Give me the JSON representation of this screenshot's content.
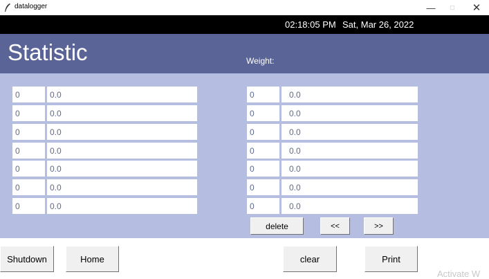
{
  "window": {
    "title": "datalogger",
    "icon": "feather-icon",
    "minimize_glyph": "—",
    "maximize_glyph": "□",
    "close_glyph": "✕"
  },
  "clock": {
    "time": "02:18:05 PM",
    "date": "Sat, Mar 26, 2022"
  },
  "header": {
    "title": "Statistic",
    "weight_label": "Weight:"
  },
  "left_rows": [
    {
      "index": "0",
      "value": "0.0"
    },
    {
      "index": "0",
      "value": "0.0"
    },
    {
      "index": "0",
      "value": "0.0"
    },
    {
      "index": "0",
      "value": "0.0"
    },
    {
      "index": "0",
      "value": "0.0"
    },
    {
      "index": "0",
      "value": "0.0"
    },
    {
      "index": "0",
      "value": "0.0"
    }
  ],
  "right_rows": [
    {
      "index": "0",
      "value": "0.0"
    },
    {
      "index": "0",
      "value": "0.0"
    },
    {
      "index": "0",
      "value": "0.0"
    },
    {
      "index": "0",
      "value": "0.0"
    },
    {
      "index": "0",
      "value": "0.0"
    },
    {
      "index": "0",
      "value": "0.0"
    },
    {
      "index": "0",
      "value": "0.0"
    }
  ],
  "nav": {
    "delete": "delete",
    "prev": "<<",
    "next": ">>"
  },
  "footer": {
    "shutdown": "Shutdown",
    "home": "Home",
    "clear": "clear",
    "print": "Print"
  },
  "watermark": "Activate W",
  "colors": {
    "header_bg": "#5b6496",
    "panel_bg": "#b5bde0",
    "clock_bg": "#000000"
  }
}
